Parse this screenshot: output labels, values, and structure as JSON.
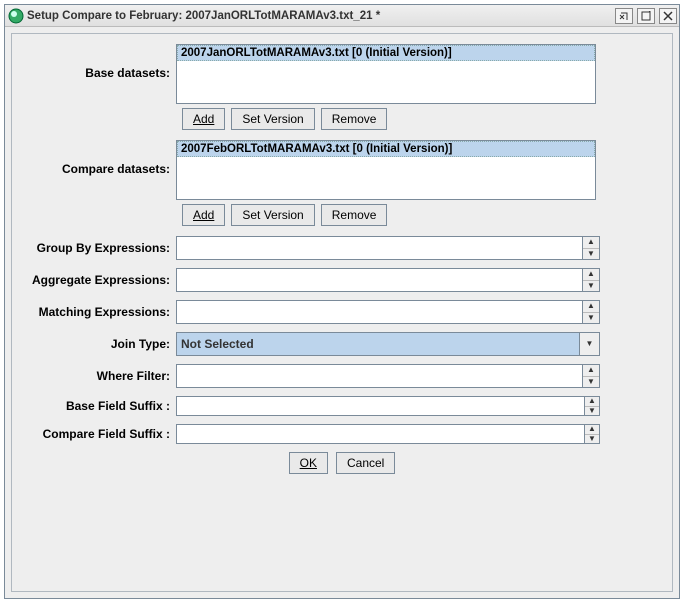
{
  "window": {
    "title": "Setup Compare to February: 2007JanORLTotMARAMAv3.txt_21 *"
  },
  "base": {
    "label": "Base datasets:",
    "items": [
      "2007JanORLTotMARAMAv3.txt [0 (Initial Version)]"
    ],
    "add": "Add",
    "setver": "Set Version",
    "remove": "Remove"
  },
  "compare": {
    "label": "Compare datasets:",
    "items": [
      "2007FebORLTotMARAMAv3.txt [0 (Initial Version)]"
    ],
    "add": "Add",
    "setver": "Set Version",
    "remove": "Remove"
  },
  "fields": {
    "groupby": {
      "label": "Group By Expressions:",
      "value": ""
    },
    "aggregate": {
      "label": "Aggregate Expressions:",
      "value": ""
    },
    "matching": {
      "label": "Matching Expressions:",
      "value": ""
    },
    "jointype": {
      "label": "Join Type:",
      "value": "Not Selected"
    },
    "where": {
      "label": "Where Filter:",
      "value": ""
    },
    "basesuffix": {
      "label": "Base Field Suffix :",
      "value": ""
    },
    "cmpsuffix": {
      "label": "Compare Field Suffix :",
      "value": ""
    }
  },
  "buttons": {
    "ok": "OK",
    "cancel": "Cancel"
  }
}
